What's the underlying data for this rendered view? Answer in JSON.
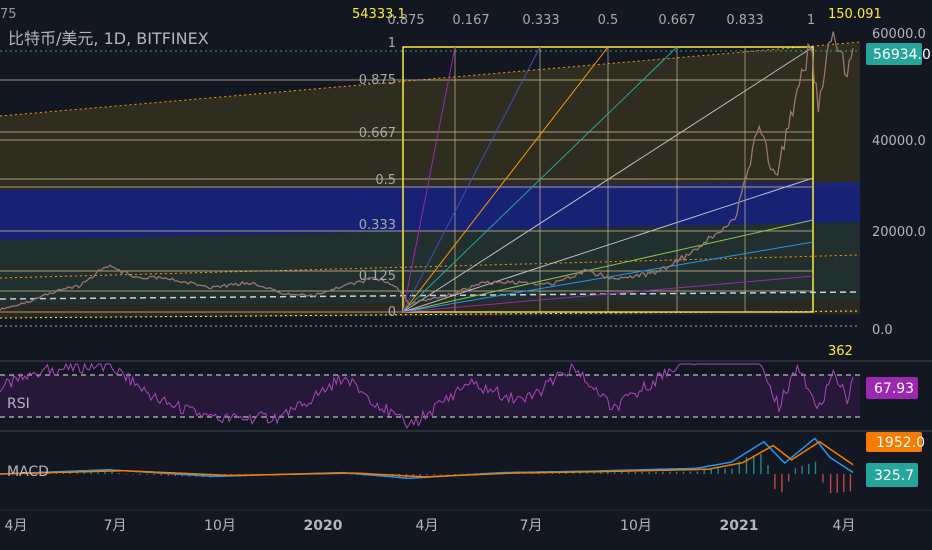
{
  "symbol": {
    "title": "比特币/美元, 1D, BITFINEX",
    "corner_label": "75"
  },
  "top_scale": {
    "left_value": "54333.1",
    "ratios": [
      "0.875",
      "0.167",
      "0.333",
      "0.5",
      "0.667",
      "0.833",
      "1"
    ],
    "right_value": "150.091"
  },
  "retracement_labels": [
    "1",
    "0.875",
    "0.667",
    "0.5",
    "0.333",
    "0.125",
    "0"
  ],
  "bar_count": "362",
  "price_axis": {
    "ticks": [
      "60000.0",
      "40000.0",
      "20000.0",
      "0.0"
    ]
  },
  "last_price": {
    "value": "56934.0",
    "color": "#26a69a"
  },
  "rsi": {
    "label": "RSI",
    "value": "67.93",
    "color": "#9c27b0",
    "upper": 70,
    "lower": 30
  },
  "macd": {
    "label": "MACD",
    "signal_value": "1952.0",
    "macd_value": "325.7",
    "signal_color": "#f57c00",
    "macd_color": "#26a69a",
    "line_color": "#2196f3"
  },
  "time_axis": {
    "labels": [
      "4月",
      "7月",
      "10月",
      "2020",
      "4月",
      "7月",
      "10月",
      "2021",
      "4月"
    ]
  },
  "chart_data": {
    "type": "line",
    "title": "比特币/美元, 1D, BITFINEX",
    "x_range": [
      "2019-03-25",
      "2021-04-05"
    ],
    "ylim": [
      0,
      60000
    ],
    "series": [
      {
        "name": "比特币/美元",
        "points": [
          [
            "2019-03-25",
            4000
          ],
          [
            "2019-04-15",
            5200
          ],
          [
            "2019-05-15",
            8000
          ],
          [
            "2019-06-01",
            8600
          ],
          [
            "2019-06-26",
            12900
          ],
          [
            "2019-07-20",
            10500
          ],
          [
            "2019-08-15",
            10200
          ],
          [
            "2019-09-25",
            8400
          ],
          [
            "2019-10-26",
            9400
          ],
          [
            "2019-11-25",
            7200
          ],
          [
            "2019-12-18",
            6700
          ],
          [
            "2020-01-15",
            8700
          ],
          [
            "2020-02-13",
            10300
          ],
          [
            "2020-03-01",
            8600
          ],
          [
            "2020-03-12",
            5000
          ],
          [
            "2020-03-15",
            5300
          ],
          [
            "2020-04-15",
            6900
          ],
          [
            "2020-05-15",
            9300
          ],
          [
            "2020-06-15",
            9400
          ],
          [
            "2020-07-15",
            9200
          ],
          [
            "2020-08-10",
            11800
          ],
          [
            "2020-09-05",
            10200
          ],
          [
            "2020-10-10",
            11300
          ],
          [
            "2020-11-10",
            15300
          ],
          [
            "2020-12-01",
            19200
          ],
          [
            "2020-12-20",
            23500
          ],
          [
            "2021-01-08",
            41000
          ],
          [
            "2021-01-22",
            30500
          ],
          [
            "2021-02-08",
            46000
          ],
          [
            "2021-02-21",
            57500
          ],
          [
            "2021-02-28",
            45000
          ],
          [
            "2021-03-13",
            61000
          ],
          [
            "2021-03-25",
            52000
          ],
          [
            "2021-03-30",
            56934
          ]
        ]
      }
    ],
    "rsi_series": {
      "name": "RSI",
      "points": [
        [
          "2019-03-25",
          58
        ],
        [
          "2019-05-01",
          74
        ],
        [
          "2019-06-26",
          80
        ],
        [
          "2019-08-10",
          45
        ],
        [
          "2019-09-25",
          28
        ],
        [
          "2019-11-25",
          30
        ],
        [
          "2020-01-15",
          68
        ],
        [
          "2020-03-12",
          20
        ],
        [
          "2020-05-01",
          62
        ],
        [
          "2020-06-20",
          45
        ],
        [
          "2020-08-01",
          78
        ],
        [
          "2020-09-05",
          38
        ],
        [
          "2020-11-05",
          85
        ],
        [
          "2021-01-08",
          88
        ],
        [
          "2021-01-25",
          40
        ],
        [
          "2021-02-10",
          78
        ],
        [
          "2021-03-01",
          40
        ],
        [
          "2021-03-13",
          70
        ],
        [
          "2021-03-25",
          48
        ],
        [
          "2021-03-30",
          67.93
        ]
      ]
    },
    "macd_series": {
      "name": "MACD",
      "points": [
        [
          "2019-03-25",
          0
        ],
        [
          "2019-06-26",
          900
        ],
        [
          "2019-09-25",
          -500
        ],
        [
          "2020-01-15",
          300
        ],
        [
          "2020-03-12",
          -900
        ],
        [
          "2020-06-01",
          300
        ],
        [
          "2020-08-15",
          600
        ],
        [
          "2020-11-15",
          1200
        ],
        [
          "2020-12-15",
          2500
        ],
        [
          "2021-01-12",
          6800
        ],
        [
          "2021-01-30",
          2300
        ],
        [
          "2021-02-25",
          7500
        ],
        [
          "2021-03-10",
          3500
        ],
        [
          "2021-03-30",
          325.7
        ]
      ]
    },
    "signal_series": {
      "name": "Signal",
      "points": [
        [
          "2019-03-25",
          0
        ],
        [
          "2019-07-10",
          700
        ],
        [
          "2019-10-10",
          -300
        ],
        [
          "2020-01-25",
          200
        ],
        [
          "2020-03-25",
          -600
        ],
        [
          "2020-06-10",
          200
        ],
        [
          "2020-08-25",
          500
        ],
        [
          "2020-11-25",
          1000
        ],
        [
          "2020-12-25",
          2400
        ],
        [
          "2021-01-20",
          6000
        ],
        [
          "2021-02-05",
          3000
        ],
        [
          "2021-03-01",
          6800
        ],
        [
          "2021-03-30",
          1952.0
        ]
      ]
    }
  }
}
